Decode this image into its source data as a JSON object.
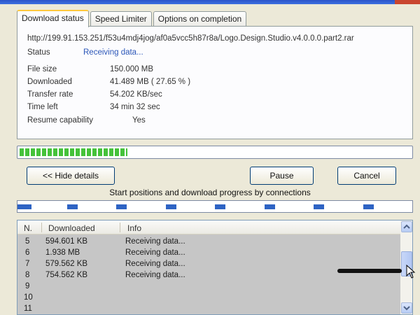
{
  "tabs": [
    "Download status",
    "Speed Limiter",
    "Options on completion"
  ],
  "url": "http://199.91.153.251/f53u4mdj4jog/af0a5vcc5h87r8a/Logo.Design.Studio.v4.0.0.0.part2.rar",
  "status": {
    "label": "Status",
    "value": "Receiving data..."
  },
  "info": [
    {
      "label": "File size",
      "value": "150.000  MB"
    },
    {
      "label": "Downloaded",
      "value": "41.489  MB  ( 27.65 % )"
    },
    {
      "label": "Transfer rate",
      "value": "54.202  KB/sec"
    },
    {
      "label": "Time left",
      "value": "34 min 32 sec"
    },
    {
      "label": "Resume capability",
      "value": "Yes"
    }
  ],
  "progress_percent": 27.65,
  "buttons": {
    "hide_details": "<< Hide details",
    "pause": "Pause",
    "cancel": "Cancel"
  },
  "connections_caption": "Start positions and download progress by connections",
  "connection_count": 8,
  "list": {
    "headers": [
      "N.",
      "Downloaded",
      "Info"
    ],
    "rows": [
      {
        "n": "5",
        "downloaded": "594.601  KB",
        "info": "Receiving data..."
      },
      {
        "n": "6",
        "downloaded": "1.938  MB",
        "info": "Receiving data..."
      },
      {
        "n": "7",
        "downloaded": "579.562  KB",
        "info": "Receiving data..."
      },
      {
        "n": "8",
        "downloaded": "754.562  KB",
        "info": "Receiving data..."
      },
      {
        "n": "9",
        "downloaded": "",
        "info": ""
      },
      {
        "n": "10",
        "downloaded": "",
        "info": ""
      },
      {
        "n": "11",
        "downloaded": "",
        "info": ""
      }
    ]
  },
  "icons": {
    "scroll_up": "chevron-up-icon",
    "scroll_down": "chevron-down-icon",
    "cursor": "mouse-pointer-icon"
  },
  "colors": {
    "progress": "#45c23a",
    "connection_segment": "#2e63c4",
    "status_text": "#2b56b8",
    "active_tab_accent": "#ffc83c"
  }
}
